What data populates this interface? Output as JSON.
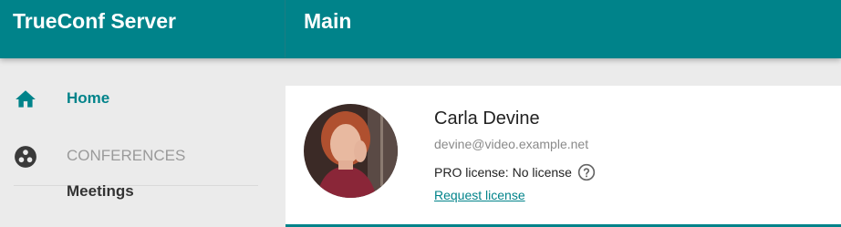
{
  "app": {
    "brand": "TrueConf Server",
    "page_title": "Main"
  },
  "sidebar": {
    "home_label": "Home",
    "section_label": "CONFERENCES",
    "meetings_label": "Meetings"
  },
  "profile": {
    "name": "Carla Devine",
    "email": "devine@video.example.net",
    "license_text": "PRO license: No license",
    "request_label": "Request license"
  },
  "colors": {
    "accent": "#00838a",
    "sidebar_bg": "#ebebeb",
    "card_bg": "#ffffff"
  },
  "icons": {
    "home": "home-icon",
    "conferences": "conferences-icon",
    "help": "help-icon"
  }
}
